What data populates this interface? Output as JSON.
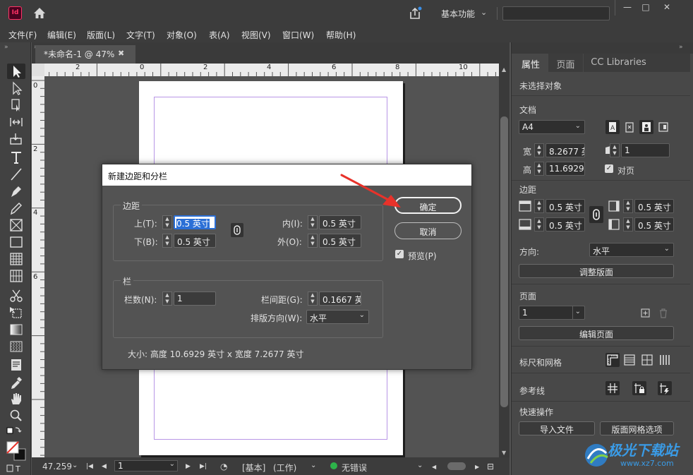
{
  "app": {
    "logo_text": "Id",
    "workspace": "基本功能"
  },
  "menu": [
    "文件(F)",
    "编辑(E)",
    "版面(L)",
    "文字(T)",
    "对象(O)",
    "表(A)",
    "视图(V)",
    "窗口(W)",
    "帮助(H)"
  ],
  "document_tab": {
    "title": "*未命名-1 @ 47%",
    "close": "✖"
  },
  "rulers": {
    "h_labels": [
      "2",
      "0",
      "2",
      "4",
      "6",
      "8",
      "10"
    ],
    "v_labels": [
      "0",
      "2",
      "4",
      "6"
    ]
  },
  "status": {
    "zoom": "47.259",
    "page": "1",
    "style": "[基本]",
    "mode": "(工作)",
    "errors": "无错误"
  },
  "panel": {
    "tabs": [
      "属性",
      "页面",
      "CC Libraries"
    ],
    "no_selection": "未选择对象",
    "document_section": "文档",
    "preset": "A4",
    "width_label": "宽",
    "width_value": "8.2677 英",
    "height_label": "高",
    "height_value": "11.6929",
    "pages_value": "1",
    "facing_pages": "对页",
    "margins_section": "边距",
    "margin_top": "0.5 英寸",
    "margin_bottom": "0.5 英寸",
    "margin_inside": "0.5 英寸",
    "margin_outside": "0.5 英寸",
    "direction_label": "方向:",
    "direction_value": "水平",
    "adjust_layout": "调整版面",
    "pages_section": "页面",
    "page_value": "1",
    "edit_page": "编辑页面",
    "rulers_grids": "标尺和网格",
    "guides": "参考线",
    "quick_actions": "快速操作",
    "import_file": "导入文件",
    "layout_grid_options": "版面网格选项"
  },
  "dialog": {
    "title": "新建边距和分栏",
    "margins_group": "边距",
    "top_label": "上(T):",
    "top_value": "0.5 英寸",
    "bottom_label": "下(B):",
    "bottom_value": "0.5 英寸",
    "inside_label": "内(I):",
    "inside_value": "0.5 英寸",
    "outside_label": "外(O):",
    "outside_value": "0.5 英寸",
    "columns_group": "栏",
    "col_count_label": "栏数(N):",
    "col_count_value": "1",
    "gutter_label": "栏间距(G):",
    "gutter_value": "0.1667 英",
    "writing_dir_label": "排版方向(W):",
    "writing_dir_value": "水平",
    "ok": "确定",
    "cancel": "取消",
    "preview": "预览(P)",
    "size_info": "大小: 高度 10.6929 英寸 x 宽度 7.2677 英寸"
  },
  "watermark": {
    "text": "极光下载站",
    "url": "www.xz7.com"
  },
  "colors": {
    "accent": "#2b6fd6",
    "arrow": "#e8322a",
    "app_brand": "#ff3366",
    "status_ok": "#2db34a"
  }
}
